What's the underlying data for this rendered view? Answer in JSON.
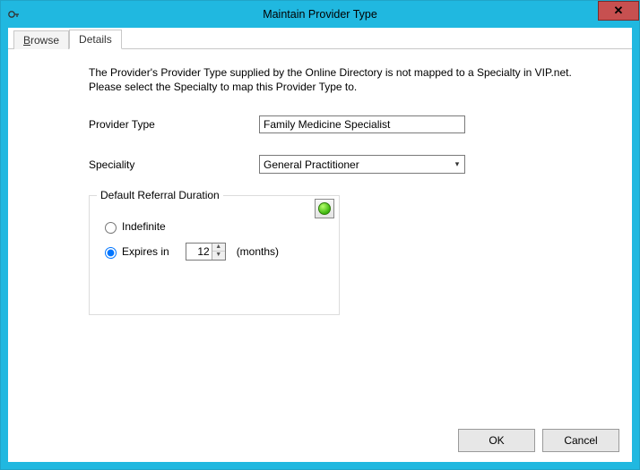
{
  "window": {
    "title": "Maintain Provider Type"
  },
  "tabs": {
    "browse": "Browse",
    "details": "Details"
  },
  "intro_line1": "The Provider's Provider Type supplied by the Online Directory is not mapped to a Specialty in VIP.net.",
  "intro_line2": "Please select the Specialty to map this Provider Type to.",
  "labels": {
    "provider_type": "Provider Type",
    "speciality": "Speciality"
  },
  "fields": {
    "provider_type_value": "Family Medicine Specialist",
    "speciality_value": "General Practitioner"
  },
  "fieldset": {
    "legend": "Default Referral Duration",
    "indefinite": "Indefinite",
    "expires_in": "Expires in",
    "months_value": "12",
    "months_suffix": "(months)"
  },
  "buttons": {
    "ok": "OK",
    "cancel": "Cancel"
  }
}
